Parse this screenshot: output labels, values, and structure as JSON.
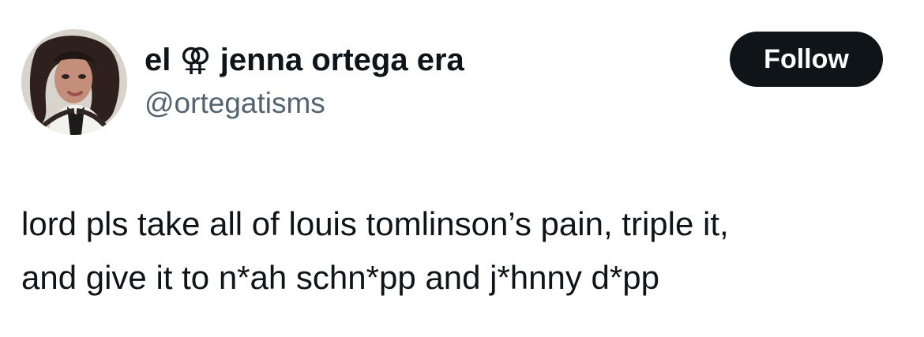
{
  "tweet": {
    "author": {
      "display_name": "el ⚢ jenna ortega era",
      "handle": "@ortegatisms",
      "avatar": "profile-photo"
    },
    "follow_label": "Follow",
    "text_lines": [
      "lord pls take all of louis tomlinson’s pain, triple it,",
      "and give it to n*ah schn*pp and j*hnny d*pp"
    ]
  },
  "colors": {
    "text_primary": "#0f1419",
    "text_secondary": "#536471",
    "button_bg": "#0f1419",
    "button_text": "#ffffff",
    "background": "#ffffff"
  }
}
